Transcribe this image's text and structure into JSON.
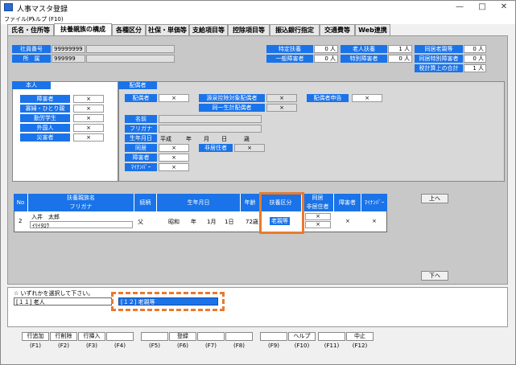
{
  "window": {
    "title": "人事マスタ登録"
  },
  "menu": [
    "ファイル(F)",
    "ヘルプ (F10)"
  ],
  "tabs": [
    "氏名・住所等",
    "扶養親族の構成",
    "各種区分",
    "社保・単価等",
    "支給項目等",
    "控除項目等",
    "振込銀行指定",
    "交通費等",
    "Web連携"
  ],
  "header": {
    "emp_no_label": "社員番号",
    "emp_no": "99999999",
    "dept_label": "所　属",
    "dept": "999999"
  },
  "counts": {
    "tokutei_label": "特定扶養",
    "tokutei": "0 人",
    "rojin_label": "老人扶養",
    "rojin": "1 人",
    "dokyo_rojin_label": "同居老親等",
    "dokyo_rojin": "0 人",
    "ippan_shogai_label": "一般障害者",
    "ippan_shogai": "0 人",
    "tokubetsu_shogai_label": "特別障害者",
    "tokubetsu_shogai": "0 人",
    "dokyo_tokubetsu_label": "同居特別障害者",
    "dokyo_tokubetsu": "0 人",
    "zeikei_label": "税計算上の合計",
    "zeikei": "1 人"
  },
  "honnin": {
    "title": "本人",
    "items": [
      {
        "label": "障害者",
        "value": "×"
      },
      {
        "label": "寡婦・ひとり親",
        "value": "×"
      },
      {
        "label": "勤労学生",
        "value": "×"
      },
      {
        "label": "外国人",
        "value": "×"
      },
      {
        "label": "災害者",
        "value": "×"
      }
    ]
  },
  "spouse": {
    "title": "配偶者",
    "haigu_label": "配偶者",
    "haigu": "×",
    "gensen_label": "源泉控除対象配偶者",
    "gensen": "×",
    "doitsu_label": "同一生計配偶者",
    "doitsu": "×",
    "shinkoku_label": "配偶者申告",
    "shinkoku": "×",
    "name_label": "名前",
    "kana_label": "フリガナ",
    "birth_label": "生年月日",
    "birth_era": "平成",
    "birth_y": "年",
    "birth_m": "月",
    "birth_d": "日",
    "birth_age": "歳",
    "dokyo_label": "同居",
    "dokyo": "×",
    "hikyojuu_label": "非居住者",
    "hikyojuu": "×",
    "shogai_label": "障害者",
    "shogai": "×",
    "mynumber_label": "ﾏｲﾅﾝﾊﾞｰ",
    "mynumber": "×"
  },
  "grid": {
    "headers": {
      "no": "No",
      "name": "扶養親族名",
      "kana": "フリガナ",
      "rel": "続柄",
      "birth": "生年月日",
      "age": "年齢",
      "fuyo": "扶養区分",
      "dokyo": "同居",
      "hikyo": "非居住者",
      "shogai": "障害者",
      "myno": "ﾏｲﾅﾝﾊﾞｰ"
    },
    "row": {
      "no": "2",
      "name": "入井　太郎",
      "kana": "ｲﾘｲﾀﾛｳ",
      "rel": "父",
      "era": "昭和",
      "y": "年",
      "m": "1月",
      "d": "1日",
      "age": "72歳",
      "fuyo": "老親等",
      "dokyo": "×",
      "hikyo": "×",
      "shogai": "×",
      "myno": "×"
    }
  },
  "nav": {
    "up": "上へ",
    "down": "下へ"
  },
  "prompt": "☆ いずれかを選択して下さい。",
  "options": [
    "[１１] 老人",
    "[１２] 老親等"
  ],
  "fkeys": [
    {
      "label": "行追加",
      "key": "(F1)"
    },
    {
      "label": "行削除",
      "key": "(F2)"
    },
    {
      "label": "行挿入",
      "key": "(F3)"
    },
    {
      "label": "",
      "key": "(F4)"
    },
    {
      "label": "",
      "key": "(F5)"
    },
    {
      "label": "登録",
      "key": "(F6)"
    },
    {
      "label": "",
      "key": "(F7)"
    },
    {
      "label": "",
      "key": "(F8)"
    },
    {
      "label": "",
      "key": "(F9)"
    },
    {
      "label": "ヘルプ",
      "key": "(F10)"
    },
    {
      "label": "",
      "key": "(F11)"
    },
    {
      "label": "中止",
      "key": "(F12)"
    }
  ],
  "colors": {
    "accent": "#1a73e8",
    "highlight": "#e87a2e"
  }
}
